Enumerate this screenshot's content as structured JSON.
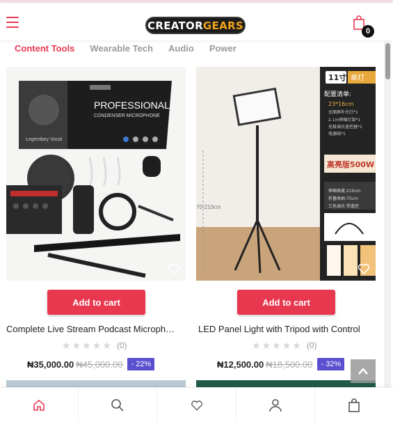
{
  "header": {
    "logo_part1": "CREATOR",
    "logo_part2": "GEARS",
    "cart_count": "0"
  },
  "categories": [
    {
      "label": "Content Tools",
      "active": true
    },
    {
      "label": "Wearable Tech",
      "active": false
    },
    {
      "label": "Audio",
      "active": false
    },
    {
      "label": "Power",
      "active": false
    }
  ],
  "products": [
    {
      "name": "Complete Live Stream Podcast Microph…",
      "add_label": "Add to cart",
      "rating_count": "(0)",
      "price": "₦35,000.00",
      "old_price": "₦45,000.00",
      "discount": "- 22%",
      "image_text": {
        "box_title": "PROFESSIONAL",
        "box_subtitle": "CONDENSER MICROPHONE",
        "box_tag": "Legendary Vocal"
      }
    },
    {
      "name": "LED Panel Light with Tripod with Control",
      "add_label": "Add to cart",
      "rating_count": "(0)",
      "price": "₦12,500.00",
      "old_price": "₦18,500.00",
      "discount": "- 32%",
      "image_text": {
        "size_tag": "11寸",
        "size_tag2": "单灯",
        "list_title": "配置清单:",
        "spec1": "23*16cm",
        "spec1b": "全面屏补光灯*1",
        "spec2": "2.1m伸缩灯架*1",
        "spec3": "无极调光遥控器*1",
        "spec4": "电源线*1",
        "banner": "高亮版500W",
        "height_label": "70-210cm",
        "dim1": "伸缩高度:210cm",
        "dim2": "折叠收纳:70cm",
        "dim3": "三色调光 带遥控"
      }
    }
  ],
  "bottom_nav": [
    {
      "icon": "home-icon"
    },
    {
      "icon": "search-icon"
    },
    {
      "icon": "heart-icon"
    },
    {
      "icon": "user-icon"
    },
    {
      "icon": "cart-icon"
    }
  ],
  "colors": {
    "accent": "#e8384f",
    "discount": "#5a4fcf",
    "inactive_text": "#9a9a9a"
  }
}
